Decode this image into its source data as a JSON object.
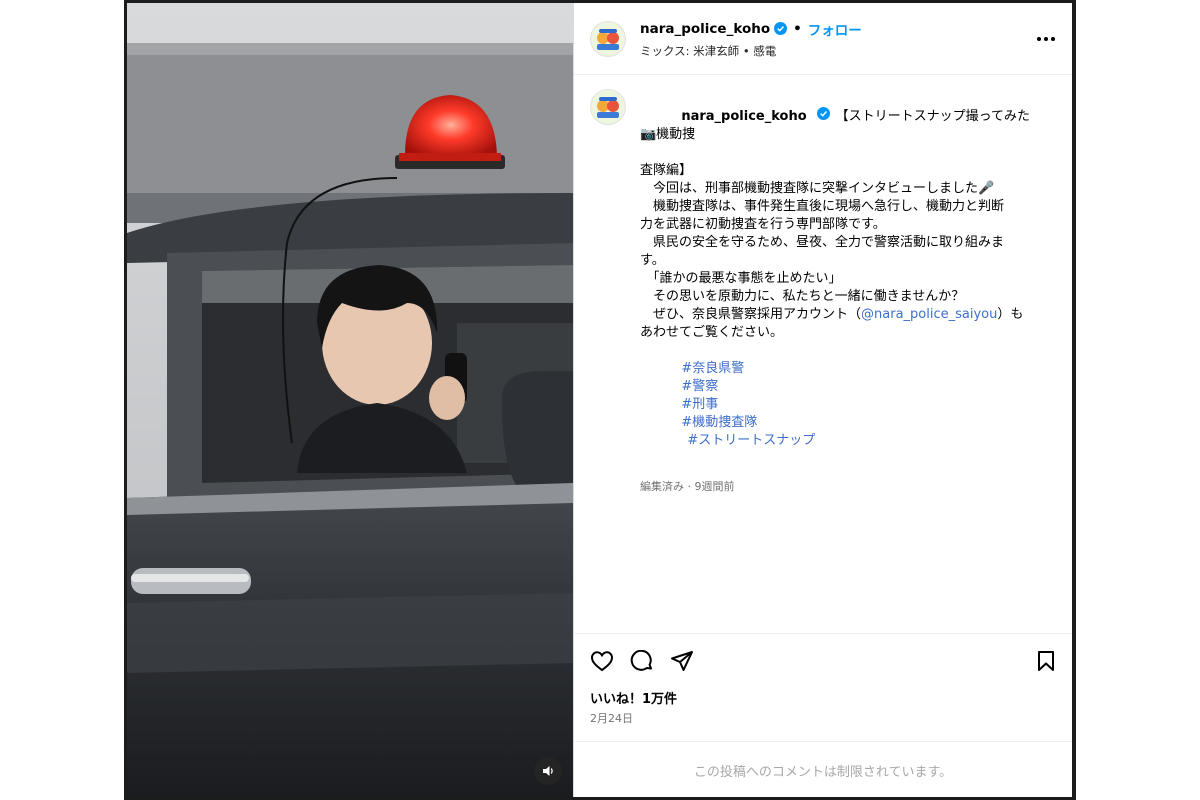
{
  "header": {
    "username": "nara_police_koho",
    "dot": "•",
    "follow_label": "フォロー",
    "audio": "ミックス: 米津玄師 • 感電"
  },
  "caption": {
    "username": "nara_police_koho",
    "line1": "【ストリートスナップ撮ってみた📷機動捜",
    "line2": "査隊編】",
    "line3": "　今回は、刑事部機動捜査隊に突撃インタビューしました🎤",
    "line4": "　機動捜査隊は、事件発生直後に現場へ急行し、機動力と判断",
    "line5": "力を武器に初動捜査を行う専門部隊です。",
    "line6": "　県民の安全を守るため、昼夜、全力で警察活動に取り組みま",
    "line7": "す。",
    "line8": "　「誰かの最悪な事態を止めたい」",
    "line9": "　その思いを原動力に、私たちと一緒に働きませんか？",
    "line10_pre": "　ぜひ、奈良県警察採用アカウント（",
    "mention": "@nara_police_saiyou",
    "line10_post": "）も",
    "line11": "あわせてご覧ください。",
    "hashtags": [
      "#奈良県警",
      "#警察",
      "#刑事",
      "#機動捜査隊",
      "#ストリートスナップ"
    ],
    "meta": "編集済み · 9週間前"
  },
  "actions": {
    "likes": "いいね！1万件",
    "date": "2月24日"
  },
  "comments_disabled": "この投稿へのコメントは制限されています。",
  "colors": {
    "accent": "#0095f6",
    "link": "#3d6ec9",
    "verified": "#0095f6",
    "muted": "#737373"
  },
  "icons": [
    "verified-badge-icon",
    "more-options-icon",
    "heart-icon",
    "comment-icon",
    "share-icon",
    "bookmark-icon",
    "speaker-icon"
  ]
}
